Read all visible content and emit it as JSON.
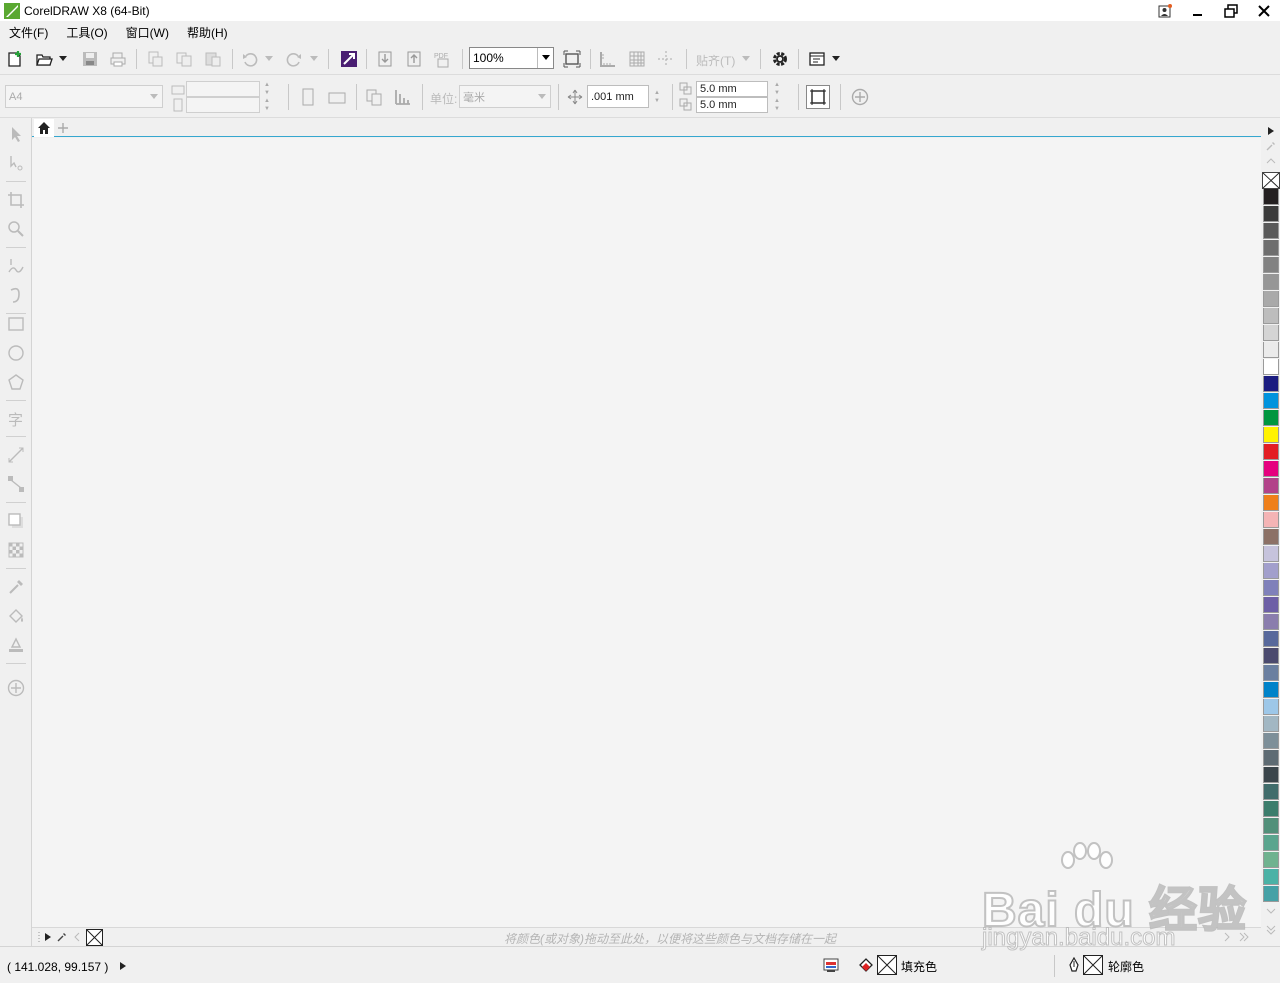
{
  "window": {
    "title": "CorelDRAW X8 (64-Bit)"
  },
  "menu": {
    "items": [
      "文件(F)",
      "工具(O)",
      "窗口(W)",
      "帮助(H)"
    ]
  },
  "toolbar": {
    "zoom_value": "100%",
    "snap_label": "贴齐(T)"
  },
  "property_bar": {
    "page_size": "A4",
    "unit_label": "单位:",
    "unit_value": "毫米",
    "nudge_value": ".001 mm",
    "duplicate_x": "5.0 mm",
    "duplicate_y": "5.0 mm"
  },
  "palette_bar": {
    "hint": "将颜色(或对象)拖动至此处，以便将这些颜色与文档存储在一起"
  },
  "status": {
    "coordinates": "( 141.028, 99.157 )",
    "fill_label": "填充色",
    "outline_label": "轮廓色"
  },
  "colors": {
    "accent": "#35a7cf",
    "logo_green": "#5aa831",
    "palette": [
      "#231f20",
      "#3b3b3b",
      "#595959",
      "#6e6e6e",
      "#828282",
      "#969696",
      "#a9a9a9",
      "#bdbdbd",
      "#d4d4d4",
      "#ebebeb",
      "#ffffff",
      "#1b1c80",
      "#0093dd",
      "#00963f",
      "#fff200",
      "#e31e24",
      "#e5007e",
      "#b24289",
      "#ef7f1a",
      "#f4b4b5",
      "#8c7166",
      "#c6c3dc",
      "#a29fcc",
      "#7f80ba",
      "#6d5fa6",
      "#8a7dad",
      "#57689b",
      "#4b4a6e",
      "#6a7fa0",
      "#0083c9",
      "#9dc7e8",
      "#a2b7c3",
      "#7d8f99",
      "#5e6b73",
      "#3b454b",
      "#406c6b",
      "#3b7d6c",
      "#52907a",
      "#5aa58e",
      "#6fb28f",
      "#4bb2a6",
      "#45a1a6"
    ]
  },
  "watermark": {
    "brand": "Bai du 经验",
    "url": "jingyan.baidu.com"
  }
}
